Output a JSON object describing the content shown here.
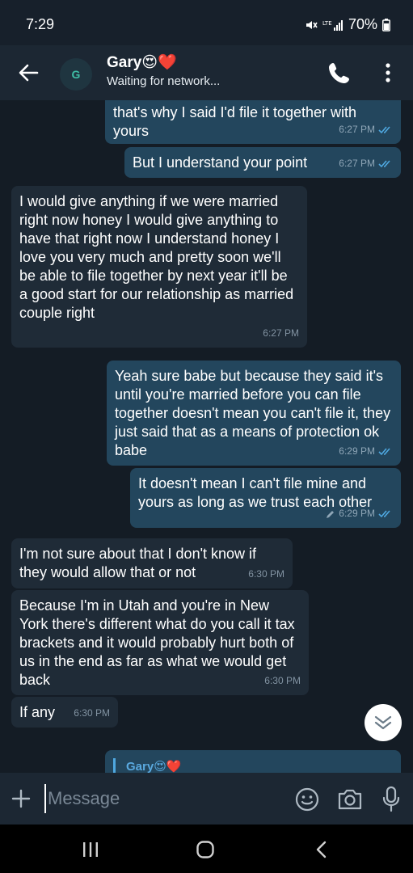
{
  "status": {
    "time": "7:29",
    "battery": "70%"
  },
  "header": {
    "avatar_letter": "G",
    "contact_name": "Gary😍❤️",
    "subtitle": "Waiting for network..."
  },
  "messages": [
    {
      "direction": "outgoing",
      "text": "that's why I said I'd file it together with yours",
      "time": "6:27 PM",
      "read": true
    },
    {
      "direction": "outgoing",
      "text": "But I understand your point",
      "time": "6:27 PM",
      "read": true
    },
    {
      "direction": "incoming",
      "text": "I would give anything if we were married right now honey I would give anything to have that right now I understand honey I love you very much and pretty soon we'll be able to file together by next year it'll be a good start for our relationship as married couple right",
      "time": "6:27 PM"
    },
    {
      "direction": "outgoing",
      "text": "Yeah sure babe but because they said it's until you're married before you can file together doesn't mean you can't file it, they just said that as a means of protection ok babe",
      "time": "6:29 PM",
      "read": true
    },
    {
      "direction": "outgoing",
      "text": "It doesn't mean I can't file mine and yours as long as we trust each other",
      "time": "6:29 PM",
      "read": true,
      "edited": true
    },
    {
      "direction": "incoming",
      "text": "I'm not sure about that I don't know if they would allow that or not",
      "time": "6:30 PM"
    },
    {
      "direction": "incoming",
      "text": "Because I'm in Utah and you're in New York there's different what do you call it tax brackets and it would probably hurt both of us in the end as far as what we would get back",
      "time": "6:30 PM"
    },
    {
      "direction": "incoming",
      "text": "If any",
      "time": "6:30 PM"
    }
  ],
  "reply_preview": {
    "name": "Gary😍❤️"
  },
  "composer": {
    "placeholder": "Message"
  },
  "icons": {
    "back": "arrow-left-icon",
    "call": "phone-icon",
    "menu": "more-vertical-icon",
    "attach": "plus-icon",
    "emoji": "smiley-icon",
    "camera": "camera-icon",
    "mic": "microphone-icon",
    "scroll_down": "double-chevron-down-icon"
  },
  "colors": {
    "background": "#141c25",
    "header": "#1c2733",
    "outgoing_bubble": "#23465d",
    "incoming_bubble": "#1f2b37",
    "read_ticks": "#4fa8e0",
    "accent_name": "#5aa9df"
  }
}
